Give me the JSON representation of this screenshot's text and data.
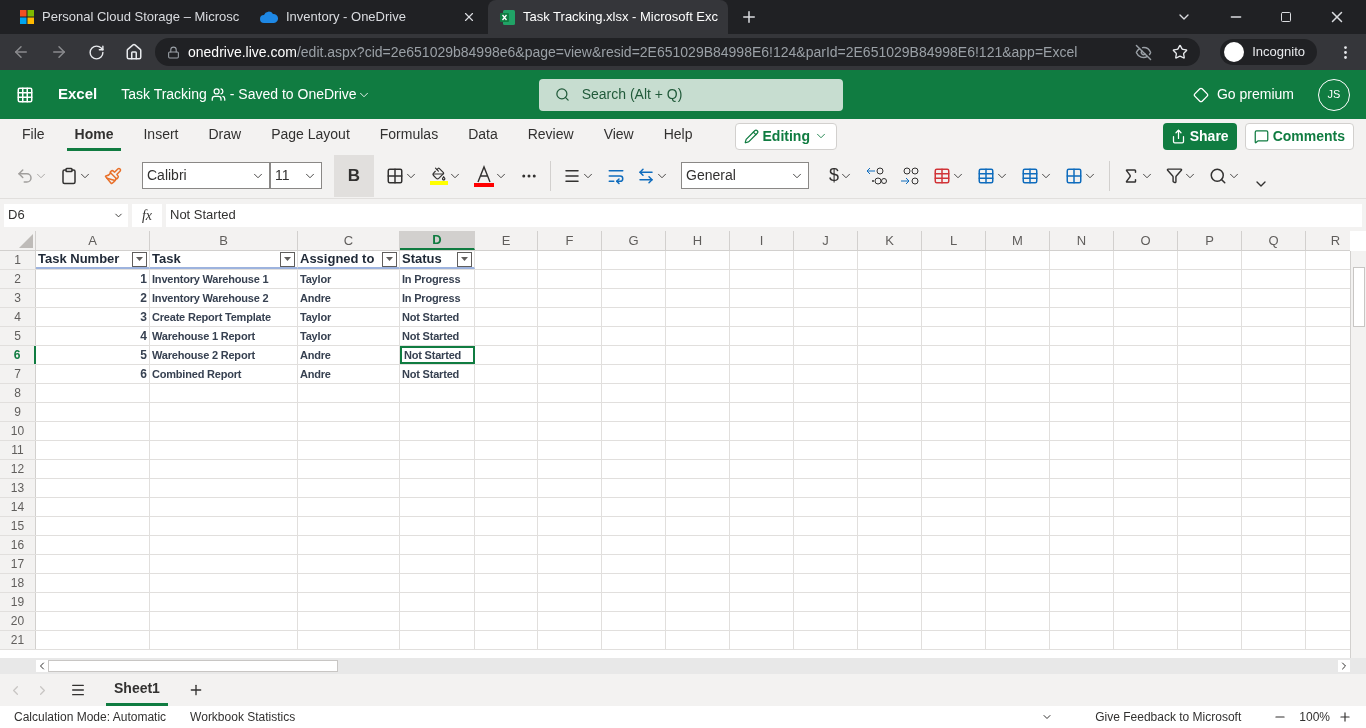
{
  "browser": {
    "tabs": [
      {
        "title": "Personal Cloud Storage – Microsc",
        "selected": false
      },
      {
        "title": "Inventory - OneDrive",
        "selected": false
      },
      {
        "title": "Task Tracking.xlsx - Microsoft Exc",
        "selected": true
      }
    ],
    "url_host": "onedrive.live.com",
    "url_path": "/edit.aspx?cid=2e651029b84998e6&page=view&resid=2E651029B84998E6!124&parId=2E651029B84998E6!121&app=Excel",
    "profile": "Incognito"
  },
  "app": {
    "name": "Excel",
    "document": "Task Tracking",
    "save_status": "- Saved to OneDrive",
    "search_placeholder": "Search (Alt + Q)",
    "premium": "Go premium",
    "avatar": "JS"
  },
  "ribbon_tabs": [
    {
      "label": "File",
      "selected": false
    },
    {
      "label": "Home",
      "selected": true
    },
    {
      "label": "Insert",
      "selected": false
    },
    {
      "label": "Draw",
      "selected": false
    },
    {
      "label": "Page Layout",
      "selected": false
    },
    {
      "label": "Formulas",
      "selected": false
    },
    {
      "label": "Data",
      "selected": false
    },
    {
      "label": "Review",
      "selected": false
    },
    {
      "label": "View",
      "selected": false
    },
    {
      "label": "Help",
      "selected": false
    }
  ],
  "mode": "Editing",
  "share": "Share",
  "comments": "Comments",
  "toolbar": {
    "font": "Calibri",
    "size": "11",
    "bold": "B",
    "number_format": "General",
    "currency": "$"
  },
  "formula_bar": {
    "name_box": "D6",
    "fx": "fx",
    "value": "Not Started"
  },
  "grid": {
    "columns": [
      {
        "label": "A",
        "selected": false
      },
      {
        "label": "B",
        "selected": false
      },
      {
        "label": "C",
        "selected": false
      },
      {
        "label": "D",
        "selected": true
      },
      {
        "label": "E",
        "selected": false
      },
      {
        "label": "F",
        "selected": false
      },
      {
        "label": "G",
        "selected": false
      },
      {
        "label": "H",
        "selected": false
      },
      {
        "label": "I",
        "selected": false
      },
      {
        "label": "J",
        "selected": false
      },
      {
        "label": "K",
        "selected": false
      },
      {
        "label": "L",
        "selected": false
      },
      {
        "label": "M",
        "selected": false
      },
      {
        "label": "N",
        "selected": false
      },
      {
        "label": "O",
        "selected": false
      },
      {
        "label": "P",
        "selected": false
      },
      {
        "label": "Q",
        "selected": false
      },
      {
        "label": "R",
        "selected": false
      }
    ],
    "rows": [
      {
        "label": "1",
        "selected": false,
        "cells": [
          {
            "text": "Task Number",
            "kind": "header",
            "selected": false
          },
          {
            "text": "Task",
            "kind": "header",
            "selected": false
          },
          {
            "text": "Assigned to",
            "kind": "header",
            "selected": false
          },
          {
            "text": "Status",
            "kind": "header",
            "selected": false
          }
        ]
      },
      {
        "label": "2",
        "selected": false,
        "cells": [
          {
            "text": "1",
            "kind": "number",
            "selected": false
          },
          {
            "text": "Inventory Warehouse 1",
            "kind": "text",
            "selected": false
          },
          {
            "text": "Taylor",
            "kind": "text",
            "selected": false
          },
          {
            "text": "In Progress",
            "kind": "text",
            "selected": false
          }
        ]
      },
      {
        "label": "3",
        "selected": false,
        "cells": [
          {
            "text": "2",
            "kind": "number",
            "selected": false
          },
          {
            "text": "Inventory Warehouse 2",
            "kind": "text",
            "selected": false
          },
          {
            "text": "Andre",
            "kind": "text",
            "selected": false
          },
          {
            "text": "In Progress",
            "kind": "text",
            "selected": false
          }
        ]
      },
      {
        "label": "4",
        "selected": false,
        "cells": [
          {
            "text": "3",
            "kind": "number",
            "selected": false
          },
          {
            "text": "Create Report Template",
            "kind": "text",
            "selected": false
          },
          {
            "text": "Taylor",
            "kind": "text",
            "selected": false
          },
          {
            "text": "Not Started",
            "kind": "text",
            "selected": false
          }
        ]
      },
      {
        "label": "5",
        "selected": false,
        "cells": [
          {
            "text": "4",
            "kind": "number",
            "selected": false
          },
          {
            "text": "Warehouse 1 Report",
            "kind": "text",
            "selected": false
          },
          {
            "text": "Taylor",
            "kind": "text",
            "selected": false
          },
          {
            "text": "Not Started",
            "kind": "text",
            "selected": false
          }
        ]
      },
      {
        "label": "6",
        "selected": true,
        "cells": [
          {
            "text": "5",
            "kind": "number",
            "selected": false
          },
          {
            "text": "Warehouse 2 Report",
            "kind": "text",
            "selected": false
          },
          {
            "text": "Andre",
            "kind": "text",
            "selected": false
          },
          {
            "text": "Not Started",
            "kind": "text",
            "selected": true
          }
        ]
      },
      {
        "label": "7",
        "selected": false,
        "cells": [
          {
            "text": "6",
            "kind": "number",
            "selected": false
          },
          {
            "text": "Combined Report",
            "kind": "text",
            "selected": false
          },
          {
            "text": "Andre",
            "kind": "text",
            "selected": false
          },
          {
            "text": "Not Started",
            "kind": "text",
            "selected": false
          }
        ]
      },
      {
        "label": "8",
        "selected": false
      },
      {
        "label": "9",
        "selected": false
      },
      {
        "label": "10",
        "selected": false
      },
      {
        "label": "11",
        "selected": false
      },
      {
        "label": "12",
        "selected": false
      },
      {
        "label": "13",
        "selected": false
      },
      {
        "label": "14",
        "selected": false
      },
      {
        "label": "15",
        "selected": false
      },
      {
        "label": "16",
        "selected": false
      },
      {
        "label": "17",
        "selected": false
      },
      {
        "label": "18",
        "selected": false
      },
      {
        "label": "19",
        "selected": false
      },
      {
        "label": "20",
        "selected": false
      },
      {
        "label": "21",
        "selected": false
      }
    ]
  },
  "sheets": [
    {
      "label": "Sheet1",
      "selected": true
    }
  ],
  "status_bar": {
    "calc": "Calculation Mode: Automatic",
    "stats": "Workbook Statistics",
    "feedback": "Give Feedback to Microsoft",
    "zoom": "100%"
  }
}
